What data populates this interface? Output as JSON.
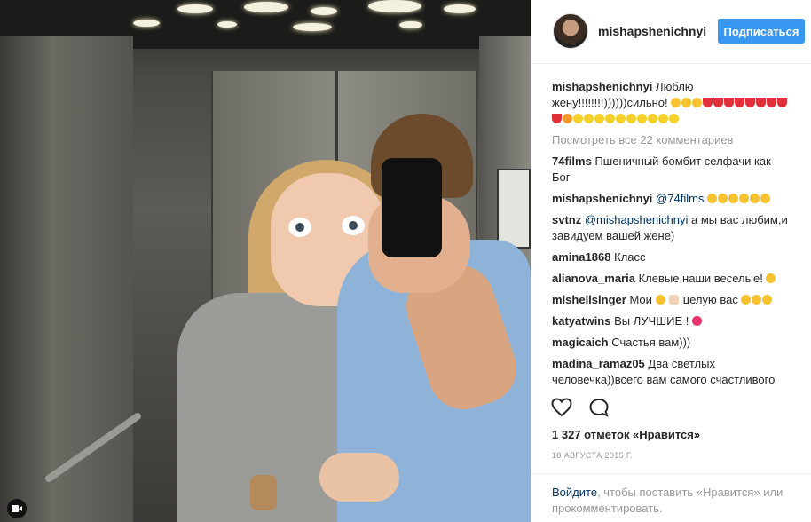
{
  "header": {
    "username": "mishapshenichnyi",
    "follow_label": "Подписаться"
  },
  "caption": {
    "username": "mishapshenichnyi",
    "text": "Люблю жену!!!!!!!!))))))сильно!"
  },
  "view_all_comments": "Посмотреть все 22 комментариев",
  "comments": [
    {
      "user": "74films",
      "text": "Пшеничный бомбит селфачи как Бог"
    },
    {
      "user": "mishapshenichnyi",
      "mention": "@74films",
      "text": ""
    },
    {
      "user": "svtnz",
      "mention": "@mishapshenichnyi",
      "text": "а мы вас любим,и завидуем вашей жене)"
    },
    {
      "user": "amina1868",
      "text": "Класс"
    },
    {
      "user": "alianova_maria",
      "text": "Клевые наши веселые!"
    },
    {
      "user": "mishellsinger",
      "text": "Мои",
      "text2": "целую вас"
    },
    {
      "user": "katyatwins",
      "text": "Вы ЛУЧШИЕ !"
    },
    {
      "user": "magicaich",
      "text": "Счастья вам)))"
    },
    {
      "user": "madina_ramaz05",
      "text": "Два светлых человечка))всего вам самого счастливого"
    }
  ],
  "likes": "1 327 отметок «Нравится»",
  "date": "18 АВГУСТА 2015 Г.",
  "footer": {
    "login_link": "Войдите",
    "login_text": ", чтобы поставить «Нравится» или прокомментировать."
  },
  "icons": {
    "like": "heart-icon",
    "comment": "comment-icon",
    "video": "video-camera-icon"
  },
  "colors": {
    "accent": "#3897f0",
    "link": "#003569",
    "muted": "#999999"
  }
}
